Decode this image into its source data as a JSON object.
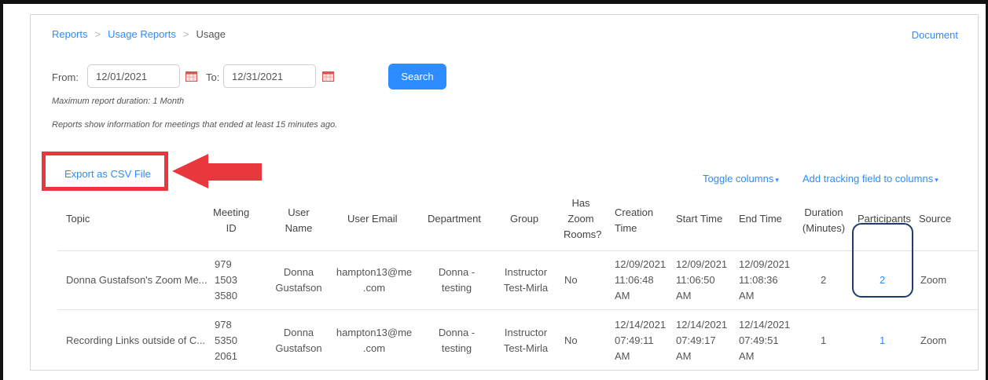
{
  "breadcrumb": {
    "item1": "Reports",
    "item2": "Usage Reports",
    "current": "Usage",
    "separator": ">"
  },
  "document_link": "Document",
  "filters": {
    "from_label": "From:",
    "from_value": "12/01/2021",
    "to_label": "To:",
    "to_value": "12/31/2021",
    "search_label": "Search",
    "calendar_icon": "calendar-icon"
  },
  "notes": {
    "max_duration": "Maximum report duration: 1 Month",
    "info": "Reports show information for meetings that ended at least 15 minutes ago."
  },
  "actions": {
    "export_label": "Export as CSV File",
    "toggle_columns": "Toggle columns",
    "tracking_field": "Add tracking field to columns",
    "caret": "▾"
  },
  "table": {
    "headers": {
      "topic": "Topic",
      "meeting_id": [
        "Meeting",
        "ID"
      ],
      "user_name": [
        "User",
        "Name"
      ],
      "user_email": "User Email",
      "department": "Department",
      "group": "Group",
      "zoom_rooms": [
        "Has",
        "Zoom",
        "Rooms?"
      ],
      "creation_time": [
        "Creation",
        "Time"
      ],
      "start_time": "Start Time",
      "end_time": "End Time",
      "duration": [
        "Duration",
        "(Minutes)"
      ],
      "participants": "Participants",
      "source": "Source"
    },
    "rows": [
      {
        "topic": "Donna Gustafson's Zoom Me...",
        "meeting_id": [
          "979",
          "1503",
          "3580"
        ],
        "user_name": [
          "Donna",
          "Gustafson"
        ],
        "user_email": [
          "hampton13@me",
          ".com"
        ],
        "department": [
          "Donna -",
          "testing"
        ],
        "group": [
          "Instructor",
          "Test-Mirla"
        ],
        "zoom_rooms": "No",
        "creation_time": [
          "12/09/2021",
          "11:06:48",
          "AM"
        ],
        "start_time": [
          "12/09/2021",
          "11:06:50",
          "AM"
        ],
        "end_time": [
          "12/09/2021",
          "11:08:36",
          "AM"
        ],
        "duration": "2",
        "participants": "2",
        "source": "Zoom"
      },
      {
        "topic": "Recording Links outside of C...",
        "meeting_id": [
          "978",
          "5350",
          "2061"
        ],
        "user_name": [
          "Donna",
          "Gustafson"
        ],
        "user_email": [
          "hampton13@me",
          ".com"
        ],
        "department": [
          "Donna -",
          "testing"
        ],
        "group": [
          "Instructor",
          "Test-Mirla"
        ],
        "zoom_rooms": "No",
        "creation_time": [
          "12/14/2021",
          "07:49:11",
          "AM"
        ],
        "start_time": [
          "12/14/2021",
          "07:49:17",
          "AM"
        ],
        "end_time": [
          "12/14/2021",
          "07:49:51",
          "AM"
        ],
        "duration": "1",
        "participants": "1",
        "source": "Zoom"
      }
    ]
  },
  "colors": {
    "accent": "#2d8cff",
    "highlight_red": "#e8383d",
    "highlight_navy": "#1f3b6f"
  }
}
